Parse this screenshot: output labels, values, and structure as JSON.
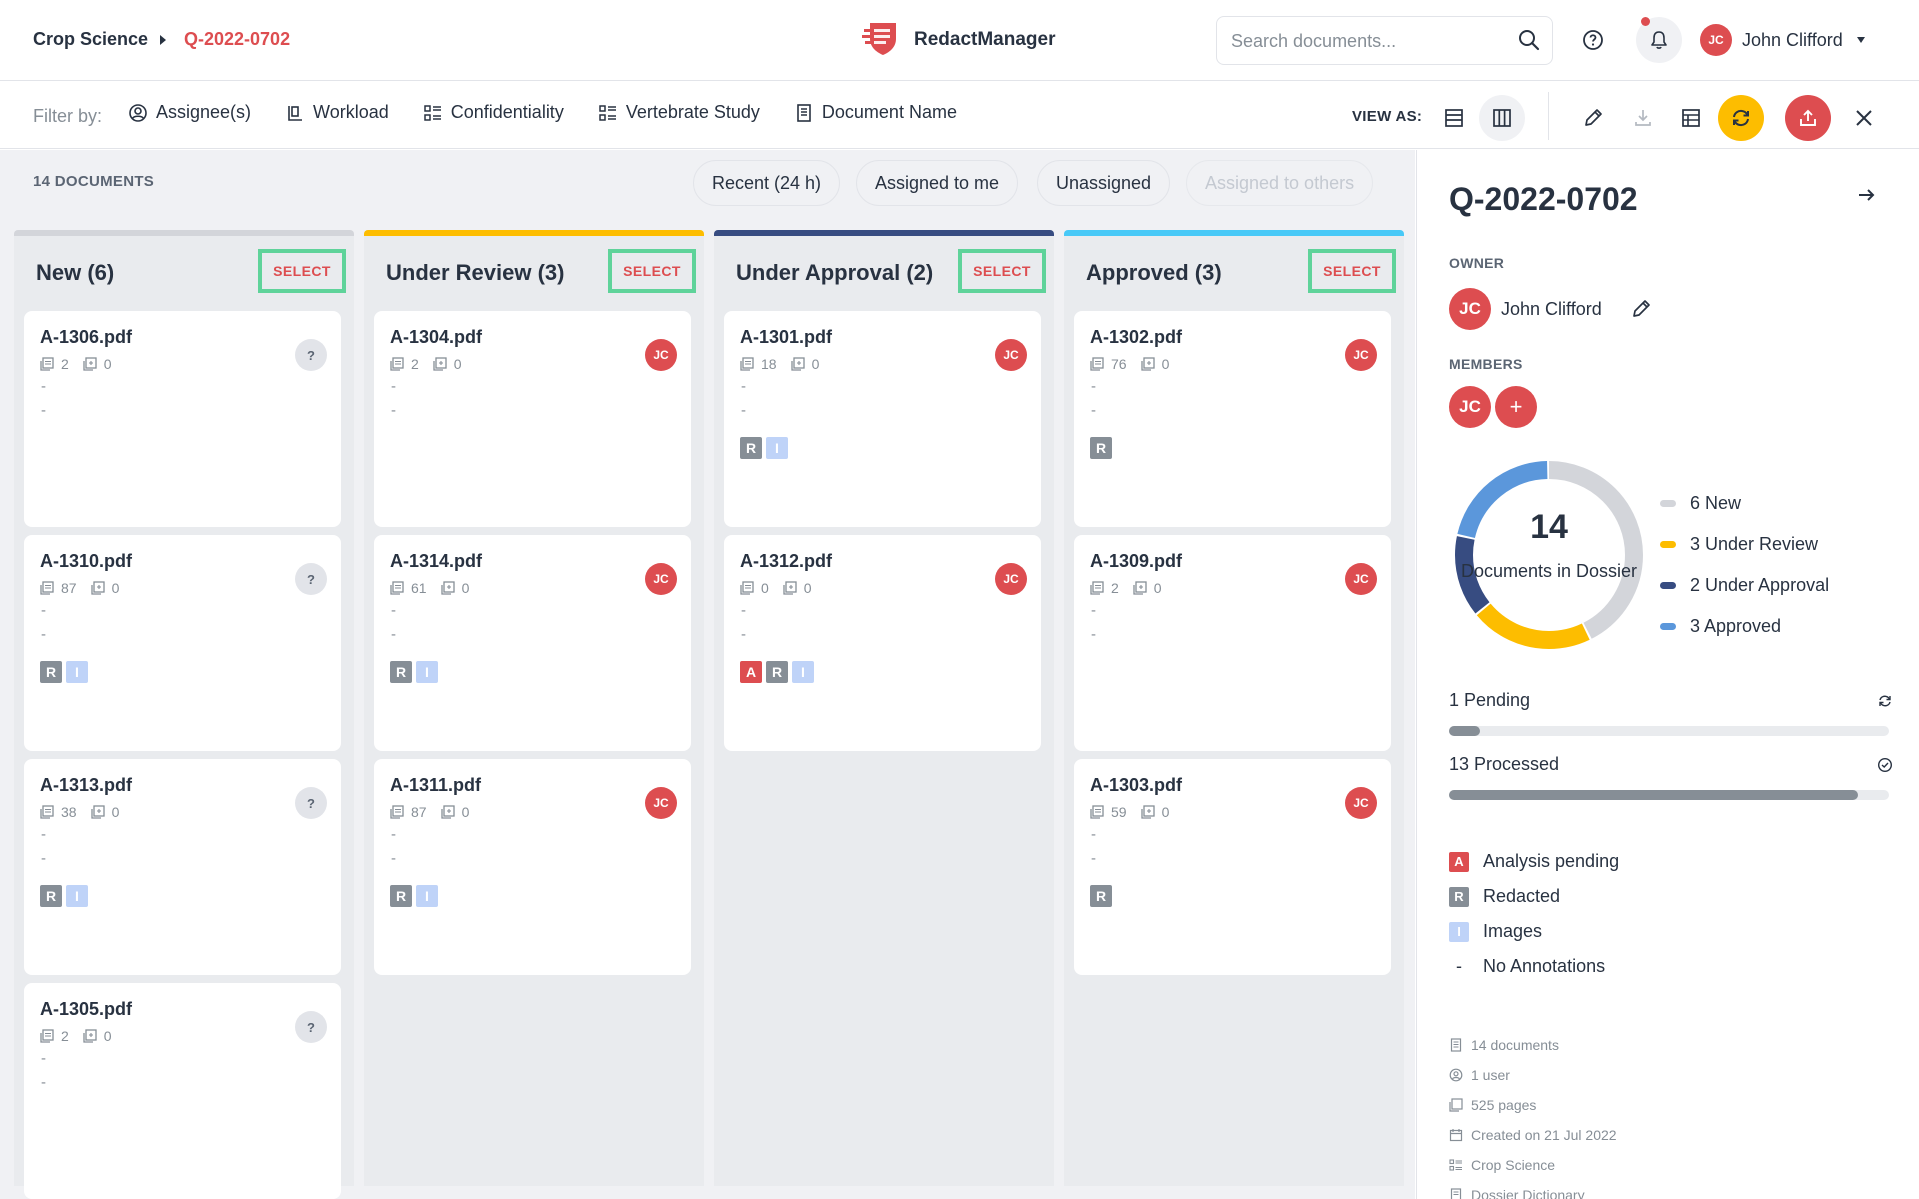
{
  "breadcrumb": {
    "root": "Crop Science",
    "current": "Q-2022-0702"
  },
  "app": {
    "name": "RedactManager"
  },
  "search": {
    "placeholder": "Search documents..."
  },
  "user": {
    "initials": "JC",
    "name": "John Clifford"
  },
  "filterbar": {
    "label": "Filter by:",
    "filters": [
      "Assignee(s)",
      "Workload",
      "Confidentiality",
      "Vertebrate Study",
      "Document Name"
    ],
    "view_as": "VIEW AS:"
  },
  "main": {
    "count": "14 DOCUMENTS",
    "quick_filters": [
      "Recent (24 h)",
      "Assigned to me",
      "Unassigned",
      "Assigned to others"
    ],
    "select_label": "SELECT",
    "columns": [
      {
        "title": "New (6)",
        "color": "#d3d5da",
        "cards": [
          {
            "name": "A-1306.pdf",
            "pages": "2",
            "annotations": "0",
            "assignee": "?",
            "tags": []
          },
          {
            "name": "A-1310.pdf",
            "pages": "87",
            "annotations": "0",
            "assignee": "?",
            "tags": [
              "R",
              "I"
            ]
          },
          {
            "name": "A-1313.pdf",
            "pages": "38",
            "annotations": "0",
            "assignee": "?",
            "tags": [
              "R",
              "I"
            ]
          },
          {
            "name": "A-1305.pdf",
            "pages": "2",
            "annotations": "0",
            "assignee": "?",
            "tags": []
          }
        ]
      },
      {
        "title": "Under Review (3)",
        "color": "#fdbd00",
        "cards": [
          {
            "name": "A-1304.pdf",
            "pages": "2",
            "annotations": "0",
            "assignee": "JC",
            "tags": []
          },
          {
            "name": "A-1314.pdf",
            "pages": "61",
            "annotations": "0",
            "assignee": "JC",
            "tags": [
              "R",
              "I"
            ]
          },
          {
            "name": "A-1311.pdf",
            "pages": "87",
            "annotations": "0",
            "assignee": "JC",
            "tags": [
              "R",
              "I"
            ]
          }
        ]
      },
      {
        "title": "Under Approval (2)",
        "color": "#374c81",
        "cards": [
          {
            "name": "A-1301.pdf",
            "pages": "18",
            "annotations": "0",
            "assignee": "JC",
            "tags": [
              "R",
              "I"
            ]
          },
          {
            "name": "A-1312.pdf",
            "pages": "0",
            "annotations": "0",
            "assignee": "JC",
            "tags": [
              "A",
              "R",
              "I"
            ]
          }
        ]
      },
      {
        "title": "Approved (3)",
        "color": "#48c9f7",
        "cards": [
          {
            "name": "A-1302.pdf",
            "pages": "76",
            "annotations": "0",
            "assignee": "JC",
            "tags": [
              "R"
            ]
          },
          {
            "name": "A-1309.pdf",
            "pages": "2",
            "annotations": "0",
            "assignee": "JC",
            "tags": []
          },
          {
            "name": "A-1303.pdf",
            "pages": "59",
            "annotations": "0",
            "assignee": "JC",
            "tags": [
              "R"
            ]
          }
        ]
      }
    ],
    "empty_marker": "-"
  },
  "sidebar": {
    "title": "Q-2022-0702",
    "owner_label": "OWNER",
    "owner_name": "John Clifford",
    "owner_initials": "JC",
    "members_label": "MEMBERS",
    "members": [
      "JC"
    ],
    "add_member": "+",
    "chart_data": {
      "type": "donut",
      "total": "14",
      "center_label": "Documents in Dossier",
      "series": [
        {
          "name": "New",
          "value": 6,
          "color": "#d3d5da"
        },
        {
          "name": "Under Review",
          "value": 3,
          "color": "#fdbd00"
        },
        {
          "name": "Under Approval",
          "value": 2,
          "color": "#374c81"
        },
        {
          "name": "Approved",
          "value": 3,
          "color": "#5b97db"
        }
      ]
    },
    "legend": [
      "6 New",
      "3 Under Review",
      "2 Under Approval",
      "3 Approved"
    ],
    "pending": {
      "label": "1 Pending",
      "fraction": 0.071
    },
    "processed": {
      "label": "13 Processed",
      "fraction": 0.929
    },
    "tag_legend": [
      {
        "tag": "A",
        "label": "Analysis pending"
      },
      {
        "tag": "R",
        "label": "Redacted"
      },
      {
        "tag": "I",
        "label": "Images"
      },
      {
        "tag": "-",
        "label": "No Annotations"
      }
    ],
    "meta": [
      "14 documents",
      "1 user",
      "525 pages",
      "Created on 21 Jul 2022",
      "Crop Science",
      "Dossier Dictionary"
    ]
  }
}
